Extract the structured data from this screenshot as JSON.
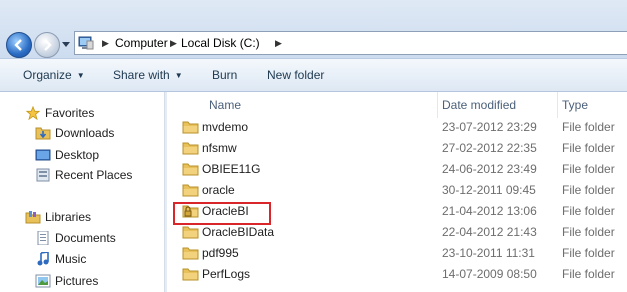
{
  "address": {
    "crumbs": [
      "Computer",
      "Local Disk (C:)"
    ]
  },
  "toolbar": {
    "organize_label": "Organize",
    "share_label": "Share with",
    "burn_label": "Burn",
    "new_folder_label": "New folder"
  },
  "nav": {
    "favorites_label": "Favorites",
    "downloads_label": "Downloads",
    "desktop_label": "Desktop",
    "recent_label": "Recent Places",
    "libraries_label": "Libraries",
    "documents_label": "Documents",
    "music_label": "Music",
    "pictures_label": "Pictures"
  },
  "columns": {
    "name": "Name",
    "date": "Date modified",
    "type": "Type"
  },
  "files": [
    {
      "name": "mvdemo",
      "date": "23-07-2012 23:29",
      "type": "File folder",
      "locked": false
    },
    {
      "name": "nfsmw",
      "date": "27-02-2012 22:35",
      "type": "File folder",
      "locked": false
    },
    {
      "name": "OBIEE11G",
      "date": "24-06-2012 23:49",
      "type": "File folder",
      "locked": false
    },
    {
      "name": "oracle",
      "date": "30-12-2011 09:45",
      "type": "File folder",
      "locked": false
    },
    {
      "name": "OracleBI",
      "date": "21-04-2012 13:06",
      "type": "File folder",
      "locked": true
    },
    {
      "name": "OracleBIData",
      "date": "22-04-2012 21:43",
      "type": "File folder",
      "locked": false
    },
    {
      "name": "pdf995",
      "date": "23-10-2011 11:31",
      "type": "File folder",
      "locked": false
    },
    {
      "name": "PerfLogs",
      "date": "14-07-2009 08:50",
      "type": "File folder",
      "locked": false
    }
  ],
  "colors": {
    "folder": "#e8c15a",
    "highlight": "#d8262a",
    "nav_blue": "#2b6cc4"
  }
}
